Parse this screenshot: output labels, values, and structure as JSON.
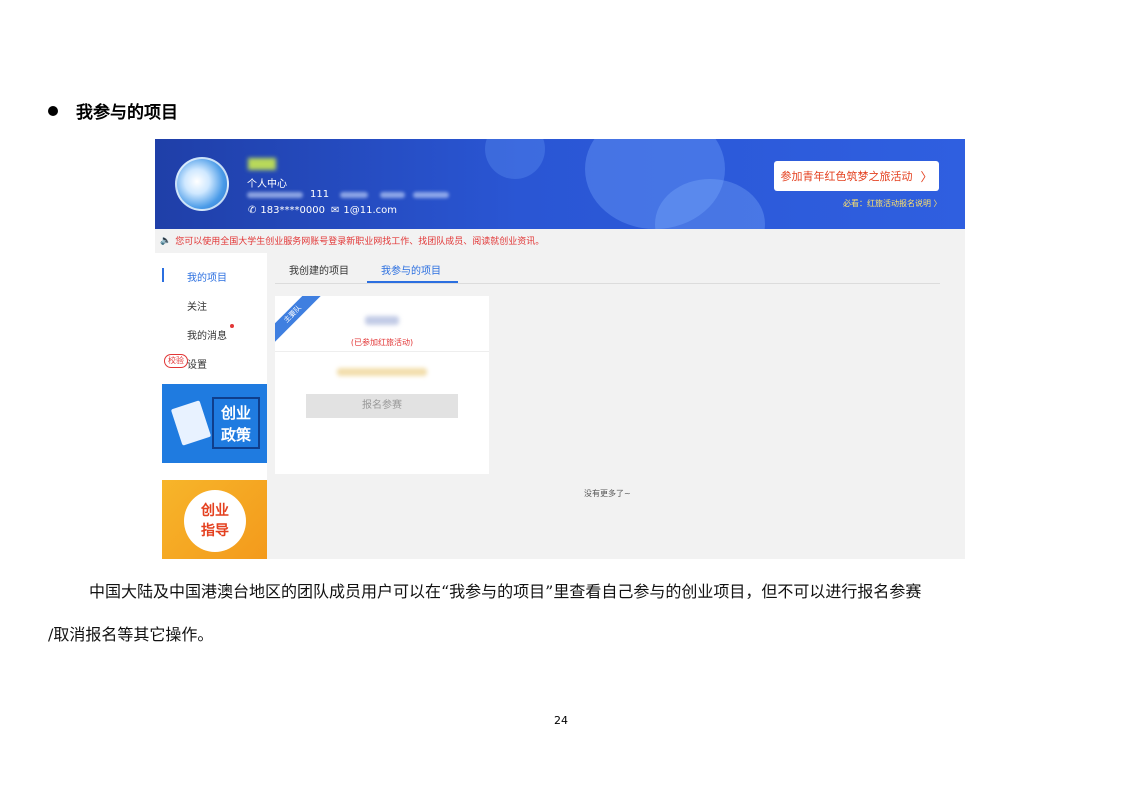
{
  "section": {
    "title": "我参与的项目"
  },
  "profile": {
    "center_label": "个人中心",
    "uid": "111",
    "phone": "183****0000",
    "email": "1@11.com"
  },
  "banner": {
    "join_button": "参加青年红色筑梦之旅活动",
    "must_read": "必看：红旅活动报名说明 〉"
  },
  "notice": "您可以使用全国大学生创业服务网账号登录新职业网找工作、找团队成员、阅读就创业资讯。",
  "sidebar": {
    "items": [
      {
        "label": "我的项目"
      },
      {
        "label": "关注"
      },
      {
        "label": "我的消息"
      },
      {
        "label": "设置"
      }
    ],
    "badge": "校验",
    "promo1": "创业政策",
    "promo1_lines": [
      "创业",
      "政策"
    ],
    "promo2_lines": [
      "创业",
      "指导"
    ]
  },
  "tabs": [
    {
      "label": "我创建的项目"
    },
    {
      "label": "我参与的项目"
    }
  ],
  "card": {
    "ribbon": "主要队",
    "status": "(已参加红旅活动)",
    "button": "报名参赛"
  },
  "list": {
    "no_more": "没有更多了~"
  },
  "paragraph": {
    "line1": "中国大陆及中国港澳台地区的团队成员用户可以在“我参与的项目”里查看自己参与的创业项目，但不可以进行报名参赛",
    "line2": "/取消报名等其它操作。"
  },
  "page_number": "24",
  "colors": {
    "accent": "#2b6fe0",
    "banner": "#2a56d4",
    "alert": "#e23636"
  }
}
